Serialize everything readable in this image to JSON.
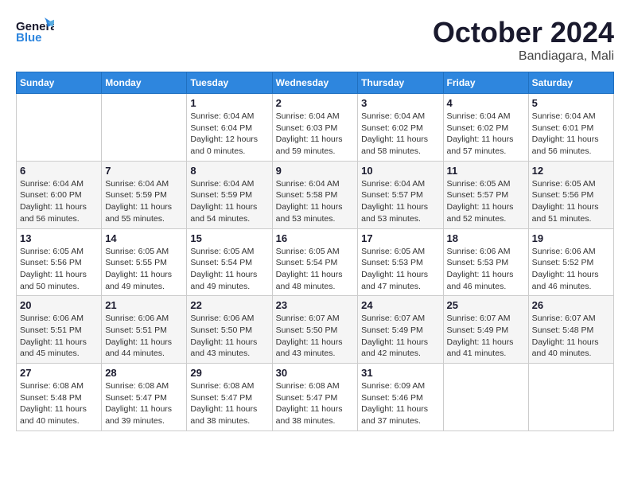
{
  "header": {
    "logo_general": "General",
    "logo_blue": "Blue",
    "month_title": "October 2024",
    "location": "Bandiagara, Mali"
  },
  "calendar": {
    "days_of_week": [
      "Sunday",
      "Monday",
      "Tuesday",
      "Wednesday",
      "Thursday",
      "Friday",
      "Saturday"
    ],
    "weeks": [
      [
        {
          "day": "",
          "info": ""
        },
        {
          "day": "",
          "info": ""
        },
        {
          "day": "1",
          "info": "Sunrise: 6:04 AM\nSunset: 6:04 PM\nDaylight: 12 hours\nand 0 minutes."
        },
        {
          "day": "2",
          "info": "Sunrise: 6:04 AM\nSunset: 6:03 PM\nDaylight: 11 hours\nand 59 minutes."
        },
        {
          "day": "3",
          "info": "Sunrise: 6:04 AM\nSunset: 6:02 PM\nDaylight: 11 hours\nand 58 minutes."
        },
        {
          "day": "4",
          "info": "Sunrise: 6:04 AM\nSunset: 6:02 PM\nDaylight: 11 hours\nand 57 minutes."
        },
        {
          "day": "5",
          "info": "Sunrise: 6:04 AM\nSunset: 6:01 PM\nDaylight: 11 hours\nand 56 minutes."
        }
      ],
      [
        {
          "day": "6",
          "info": "Sunrise: 6:04 AM\nSunset: 6:00 PM\nDaylight: 11 hours\nand 56 minutes."
        },
        {
          "day": "7",
          "info": "Sunrise: 6:04 AM\nSunset: 5:59 PM\nDaylight: 11 hours\nand 55 minutes."
        },
        {
          "day": "8",
          "info": "Sunrise: 6:04 AM\nSunset: 5:59 PM\nDaylight: 11 hours\nand 54 minutes."
        },
        {
          "day": "9",
          "info": "Sunrise: 6:04 AM\nSunset: 5:58 PM\nDaylight: 11 hours\nand 53 minutes."
        },
        {
          "day": "10",
          "info": "Sunrise: 6:04 AM\nSunset: 5:57 PM\nDaylight: 11 hours\nand 53 minutes."
        },
        {
          "day": "11",
          "info": "Sunrise: 6:05 AM\nSunset: 5:57 PM\nDaylight: 11 hours\nand 52 minutes."
        },
        {
          "day": "12",
          "info": "Sunrise: 6:05 AM\nSunset: 5:56 PM\nDaylight: 11 hours\nand 51 minutes."
        }
      ],
      [
        {
          "day": "13",
          "info": "Sunrise: 6:05 AM\nSunset: 5:56 PM\nDaylight: 11 hours\nand 50 minutes."
        },
        {
          "day": "14",
          "info": "Sunrise: 6:05 AM\nSunset: 5:55 PM\nDaylight: 11 hours\nand 49 minutes."
        },
        {
          "day": "15",
          "info": "Sunrise: 6:05 AM\nSunset: 5:54 PM\nDaylight: 11 hours\nand 49 minutes."
        },
        {
          "day": "16",
          "info": "Sunrise: 6:05 AM\nSunset: 5:54 PM\nDaylight: 11 hours\nand 48 minutes."
        },
        {
          "day": "17",
          "info": "Sunrise: 6:05 AM\nSunset: 5:53 PM\nDaylight: 11 hours\nand 47 minutes."
        },
        {
          "day": "18",
          "info": "Sunrise: 6:06 AM\nSunset: 5:53 PM\nDaylight: 11 hours\nand 46 minutes."
        },
        {
          "day": "19",
          "info": "Sunrise: 6:06 AM\nSunset: 5:52 PM\nDaylight: 11 hours\nand 46 minutes."
        }
      ],
      [
        {
          "day": "20",
          "info": "Sunrise: 6:06 AM\nSunset: 5:51 PM\nDaylight: 11 hours\nand 45 minutes."
        },
        {
          "day": "21",
          "info": "Sunrise: 6:06 AM\nSunset: 5:51 PM\nDaylight: 11 hours\nand 44 minutes."
        },
        {
          "day": "22",
          "info": "Sunrise: 6:06 AM\nSunset: 5:50 PM\nDaylight: 11 hours\nand 43 minutes."
        },
        {
          "day": "23",
          "info": "Sunrise: 6:07 AM\nSunset: 5:50 PM\nDaylight: 11 hours\nand 43 minutes."
        },
        {
          "day": "24",
          "info": "Sunrise: 6:07 AM\nSunset: 5:49 PM\nDaylight: 11 hours\nand 42 minutes."
        },
        {
          "day": "25",
          "info": "Sunrise: 6:07 AM\nSunset: 5:49 PM\nDaylight: 11 hours\nand 41 minutes."
        },
        {
          "day": "26",
          "info": "Sunrise: 6:07 AM\nSunset: 5:48 PM\nDaylight: 11 hours\nand 40 minutes."
        }
      ],
      [
        {
          "day": "27",
          "info": "Sunrise: 6:08 AM\nSunset: 5:48 PM\nDaylight: 11 hours\nand 40 minutes."
        },
        {
          "day": "28",
          "info": "Sunrise: 6:08 AM\nSunset: 5:47 PM\nDaylight: 11 hours\nand 39 minutes."
        },
        {
          "day": "29",
          "info": "Sunrise: 6:08 AM\nSunset: 5:47 PM\nDaylight: 11 hours\nand 38 minutes."
        },
        {
          "day": "30",
          "info": "Sunrise: 6:08 AM\nSunset: 5:47 PM\nDaylight: 11 hours\nand 38 minutes."
        },
        {
          "day": "31",
          "info": "Sunrise: 6:09 AM\nSunset: 5:46 PM\nDaylight: 11 hours\nand 37 minutes."
        },
        {
          "day": "",
          "info": ""
        },
        {
          "day": "",
          "info": ""
        }
      ]
    ]
  }
}
